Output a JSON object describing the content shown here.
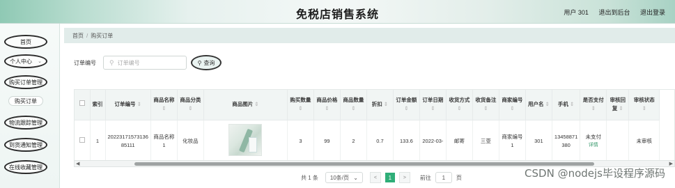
{
  "header": {
    "title": "免税店销售系统",
    "user": "用户 301",
    "back_label": "退出到后台",
    "logout_label": "退出登录"
  },
  "sidebar": {
    "items": [
      {
        "label": "首页"
      },
      {
        "label": "个人中心"
      },
      {
        "label": "购买订单管理"
      },
      {
        "label": "购买订单"
      },
      {
        "label": "物流跟踪管理"
      },
      {
        "label": "到货通知管理"
      },
      {
        "label": "在线收藏管理"
      }
    ]
  },
  "breadcrumb": {
    "home": "首页",
    "current": "购买订单"
  },
  "search": {
    "label": "订单编号",
    "placeholder": "订单编号",
    "button": "查询"
  },
  "table": {
    "headers": [
      "",
      "索引",
      "订单编号",
      "商品名称",
      "商品分类",
      "商品图片",
      "购买数量",
      "商品价格",
      "商品数量",
      "折扣",
      "订单金额",
      "订单日期",
      "收货方式",
      "收货备注",
      "商家编号",
      "用户名",
      "手机",
      "是否支付",
      "审核回复",
      "审核状态"
    ],
    "rows": [
      {
        "index": "1",
        "order_no": "20223171573136 85111",
        "name": "商品名称1",
        "category": "化妆品",
        "qty": "3",
        "price": "99",
        "count": "2",
        "discount": "0.7",
        "amount": "133.6",
        "date": "2022-03-",
        "shipping": "邮寄",
        "note": "三亚",
        "merchant": "商家编号1",
        "user": "301",
        "phone": "13458871 380",
        "paid": "未支付",
        "paid_link": "详情",
        "reply": "",
        "status": "未审核"
      }
    ]
  },
  "pagination": {
    "total": "共 1 条",
    "page_size": "10条/页",
    "current": "1",
    "goto_label": "前往",
    "goto_value": "1",
    "page_suffix": "页"
  },
  "watermark": "CSDN @nodejs毕设程序源码"
}
